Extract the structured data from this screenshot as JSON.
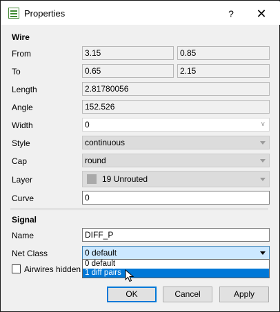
{
  "window": {
    "title": "Properties",
    "help": "?",
    "close": "✕"
  },
  "wire": {
    "heading": "Wire",
    "from_label": "From",
    "from_x": "3.15",
    "from_y": "0.85",
    "to_label": "To",
    "to_x": "0.65",
    "to_y": "2.15",
    "length_label": "Length",
    "length": "2.81780056",
    "angle_label": "Angle",
    "angle": "152.526",
    "width_label": "Width",
    "width": "0",
    "style_label": "Style",
    "style": "continuous",
    "cap_label": "Cap",
    "cap": "round",
    "layer_label": "Layer",
    "layer": "19 Unrouted",
    "layer_color": "#a9a9a9",
    "curve_label": "Curve",
    "curve": "0"
  },
  "signal": {
    "heading": "Signal",
    "name_label": "Name",
    "name": "DIFF_P",
    "netclass_label": "Net Class",
    "netclass": "0 default",
    "netclass_options": [
      "0 default",
      "1 diff pairs"
    ],
    "airwires_label": "Airwires hidden"
  },
  "buttons": {
    "ok": "OK",
    "cancel": "Cancel",
    "apply": "Apply"
  },
  "colors": {
    "accent": "#0078d7",
    "selection_bg": "#cce8ff"
  }
}
